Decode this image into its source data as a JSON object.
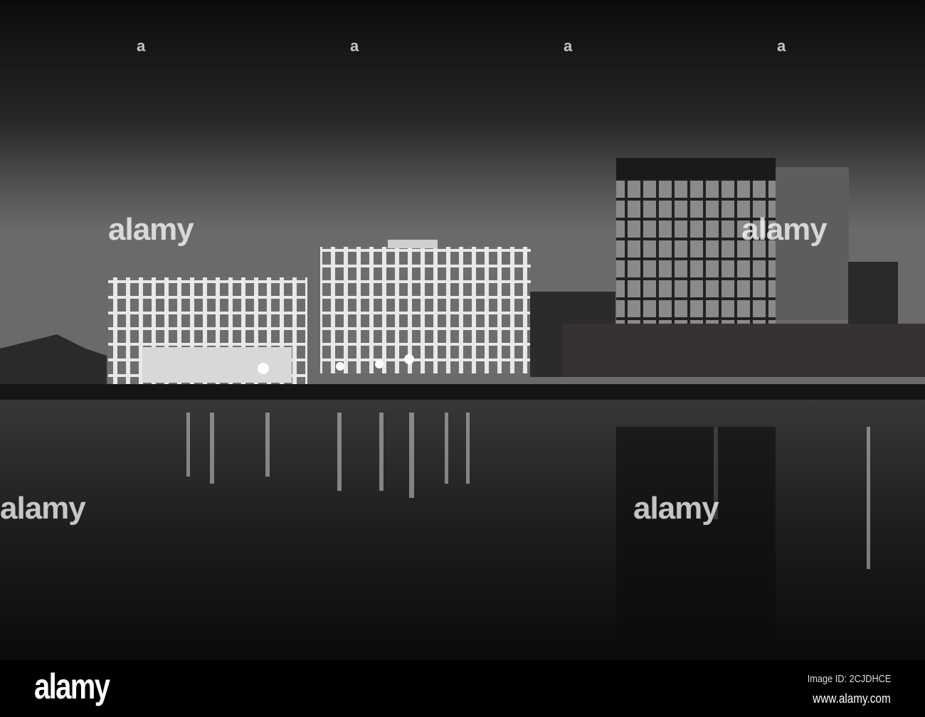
{
  "photo": {
    "watermark_text": "alamy",
    "watermark_short": "a"
  },
  "footer": {
    "logo": "alamy",
    "image_id": "Image ID: 2CJDHCE",
    "url": "www.alamy.com"
  }
}
